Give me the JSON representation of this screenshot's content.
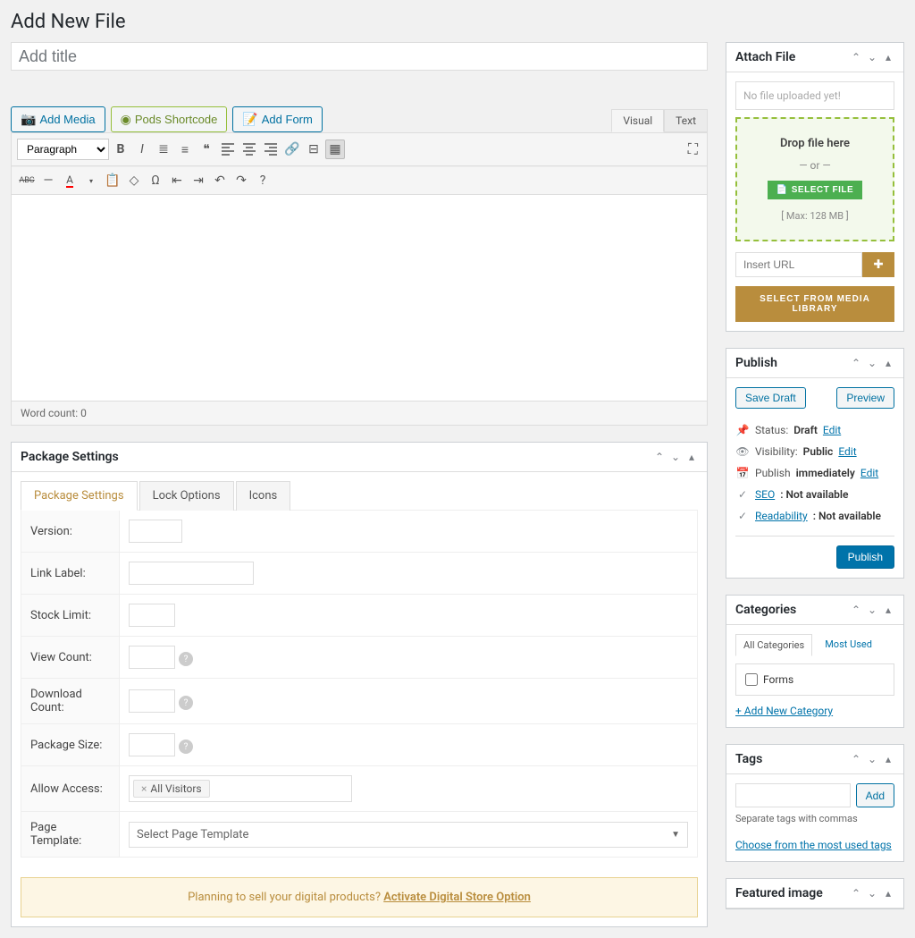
{
  "page_title": "Add New File",
  "title_placeholder": "Add title",
  "media_buttons": {
    "add_media": "Add Media",
    "pods_shortcode": "Pods Shortcode",
    "add_form": "Add Form"
  },
  "editor": {
    "tabs": {
      "visual": "Visual",
      "text": "Text"
    },
    "format_select": "Paragraph",
    "word_count_label": "Word count: 0"
  },
  "package_settings": {
    "heading": "Package Settings",
    "tabs": {
      "settings": "Package Settings",
      "lock": "Lock Options",
      "icons": "Icons"
    },
    "rows": {
      "version": "Version:",
      "link_label": "Link Label:",
      "stock_limit": "Stock Limit:",
      "view_count": "View Count:",
      "download_count": "Download Count:",
      "package_size": "Package Size:",
      "allow_access": "Allow Access:",
      "page_template": "Page Template:"
    },
    "access_chip": "All Visitors",
    "template_placeholder": "Select Page Template",
    "banner_text": "Planning to sell your digital products? ",
    "banner_link": "Activate Digital Store Option"
  },
  "attach": {
    "heading": "Attach File",
    "no_file": "No file uploaded yet!",
    "drop_here": "Drop file here",
    "or": "— or —",
    "select_file": "SELECT FILE",
    "max": "[ Max: 128 MB ]",
    "url_placeholder": "Insert URL",
    "media_library": "SELECT FROM MEDIA LIBRARY"
  },
  "publish": {
    "heading": "Publish",
    "save_draft": "Save Draft",
    "preview": "Preview",
    "status_label": "Status:",
    "status_value": "Draft",
    "visibility_label": "Visibility:",
    "visibility_value": "Public",
    "publish_label": "Publish",
    "publish_value": "immediately",
    "edit": "Edit",
    "seo_label": "SEO",
    "seo_value": ": Not available",
    "read_label": "Readability",
    "read_value": ": Not available",
    "publish_btn": "Publish"
  },
  "categories": {
    "heading": "Categories",
    "tab_all": "All Categories",
    "tab_most": "Most Used",
    "item_forms": "Forms",
    "add_new": "+ Add New Category"
  },
  "tags": {
    "heading": "Tags",
    "add": "Add",
    "note": "Separate tags with commas",
    "choose": "Choose from the most used tags"
  },
  "featured": {
    "heading": "Featured image"
  }
}
